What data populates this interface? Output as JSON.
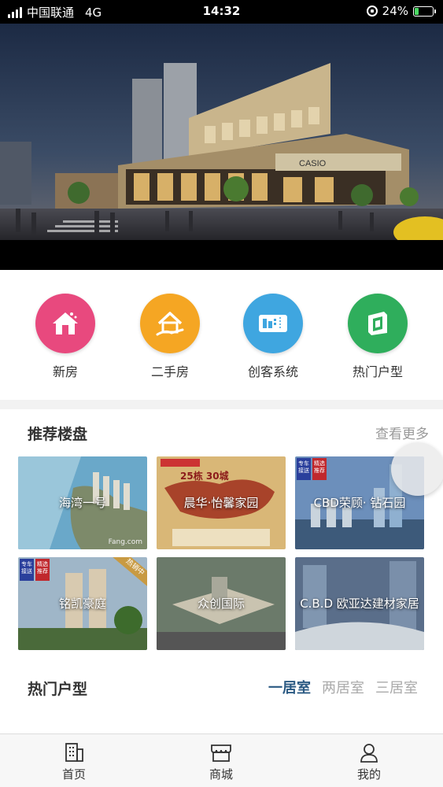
{
  "status_bar": {
    "carrier": "中国联通",
    "network": "4G",
    "time": "14:32",
    "battery_percent": "24%",
    "battery_level": 0.24
  },
  "banner": {
    "signage": "CASIO"
  },
  "categories": [
    {
      "label": "新房",
      "icon": "house-stars-icon",
      "color": "#e8497e"
    },
    {
      "label": "二手房",
      "icon": "house-hand-icon",
      "color": "#f5a623"
    },
    {
      "label": "创客系统",
      "icon": "building-ticket-icon",
      "color": "#3fa6e0"
    },
    {
      "label": "热门户型",
      "icon": "floorplan-icon",
      "color": "#2fae5c"
    }
  ],
  "recommend": {
    "title": "推荐楼盘",
    "see_more": "查看更多",
    "properties": [
      {
        "name": "海湾一号",
        "watermark": "Fang.com"
      },
      {
        "name": "晨华·怡馨家园",
        "poster_text": "25栋 30城"
      },
      {
        "name": "CBD荣顾· 钻石园",
        "tags": [
          "专车接送",
          "精选推荐"
        ]
      },
      {
        "name": "铭凯豪庭",
        "tags": [
          "专车接送",
          "精选推荐"
        ],
        "ribbon": "热销中"
      },
      {
        "name": "众创国际"
      },
      {
        "name": "C.B.D 欧亚达建材家居"
      }
    ]
  },
  "hot_layouts": {
    "title": "热门户型",
    "tabs": [
      {
        "label": "一居室",
        "active": true
      },
      {
        "label": "两居室",
        "active": false
      },
      {
        "label": "三居室",
        "active": false
      }
    ]
  },
  "bottom_nav": [
    {
      "label": "首页",
      "icon": "building-icon"
    },
    {
      "label": "商城",
      "icon": "shop-icon"
    },
    {
      "label": "我的",
      "icon": "user-icon"
    }
  ]
}
